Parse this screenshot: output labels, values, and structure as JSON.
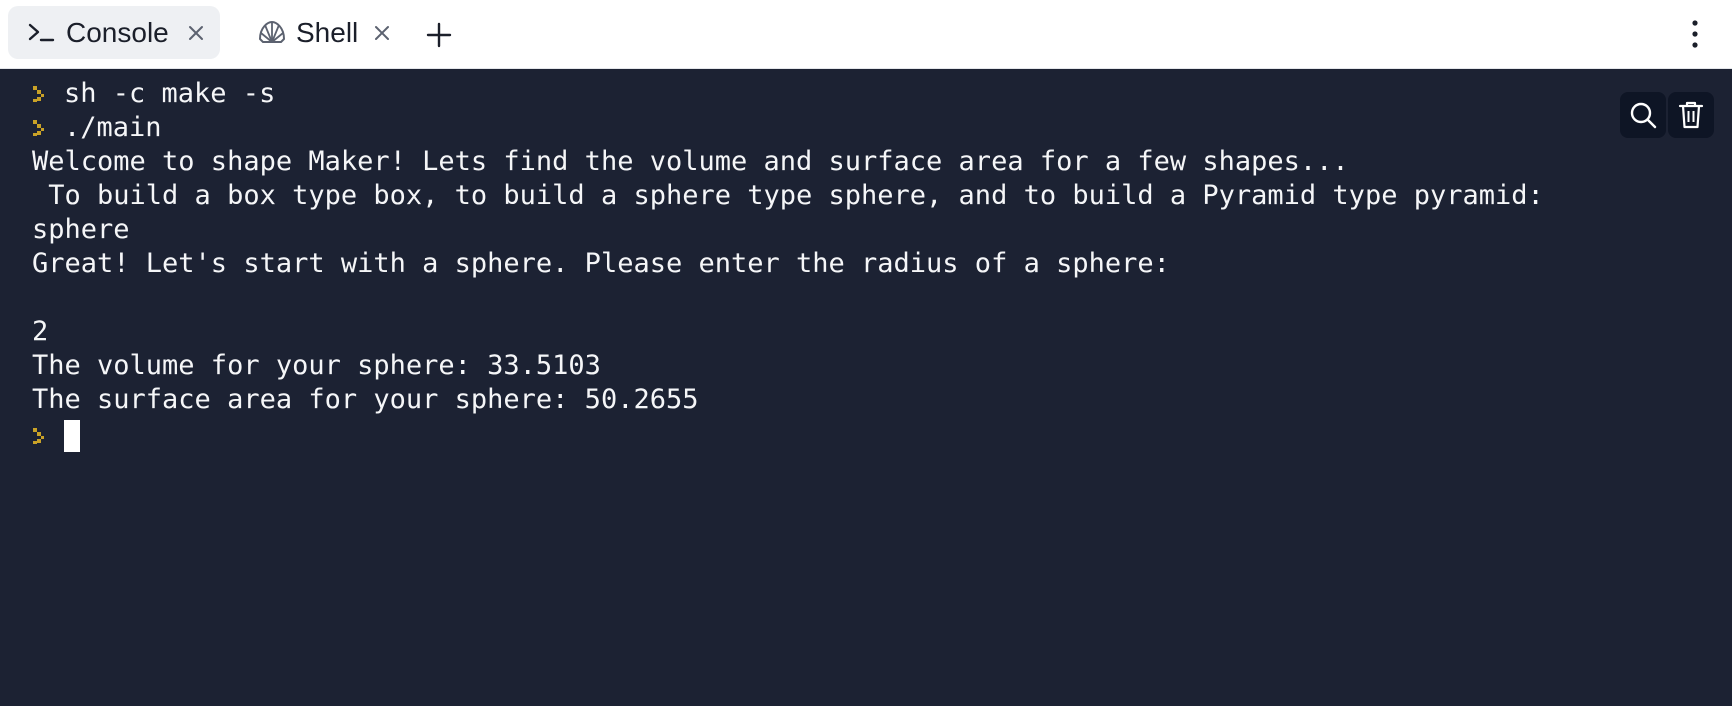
{
  "tabs": [
    {
      "label": "Console",
      "icon": "terminal-prompt-icon",
      "active": true
    },
    {
      "label": "Shell",
      "icon": "shell-icon",
      "active": false
    }
  ],
  "toolbar": {
    "add_tab_icon": "plus-icon",
    "more_icon": "vertical-ellipsis-icon",
    "search_icon": "search-icon",
    "clear_icon": "trash-icon"
  },
  "terminal": {
    "lines": [
      {
        "prompt": true,
        "text": "sh -c make -s"
      },
      {
        "prompt": true,
        "text": "./main"
      },
      {
        "prompt": false,
        "text": "Welcome to shape Maker! Lets find the volume and surface area for a few shapes..."
      },
      {
        "prompt": false,
        "text": " To build a box type box, to build a sphere type sphere, and to build a Pyramid type pyramid:"
      },
      {
        "prompt": false,
        "text": "sphere"
      },
      {
        "prompt": false,
        "text": "Great! Let's start with a sphere. Please enter the radius of a sphere:"
      },
      {
        "prompt": false,
        "text": ""
      },
      {
        "prompt": false,
        "text": "2"
      },
      {
        "prompt": false,
        "text": "The volume for your sphere: 33.5103"
      },
      {
        "prompt": false,
        "text": "The surface area for your sphere: 50.2655"
      }
    ]
  },
  "colors": {
    "terminal_bg": "#1c2233",
    "prompt_accent": "#c9a227",
    "text": "#f5f6f8"
  }
}
